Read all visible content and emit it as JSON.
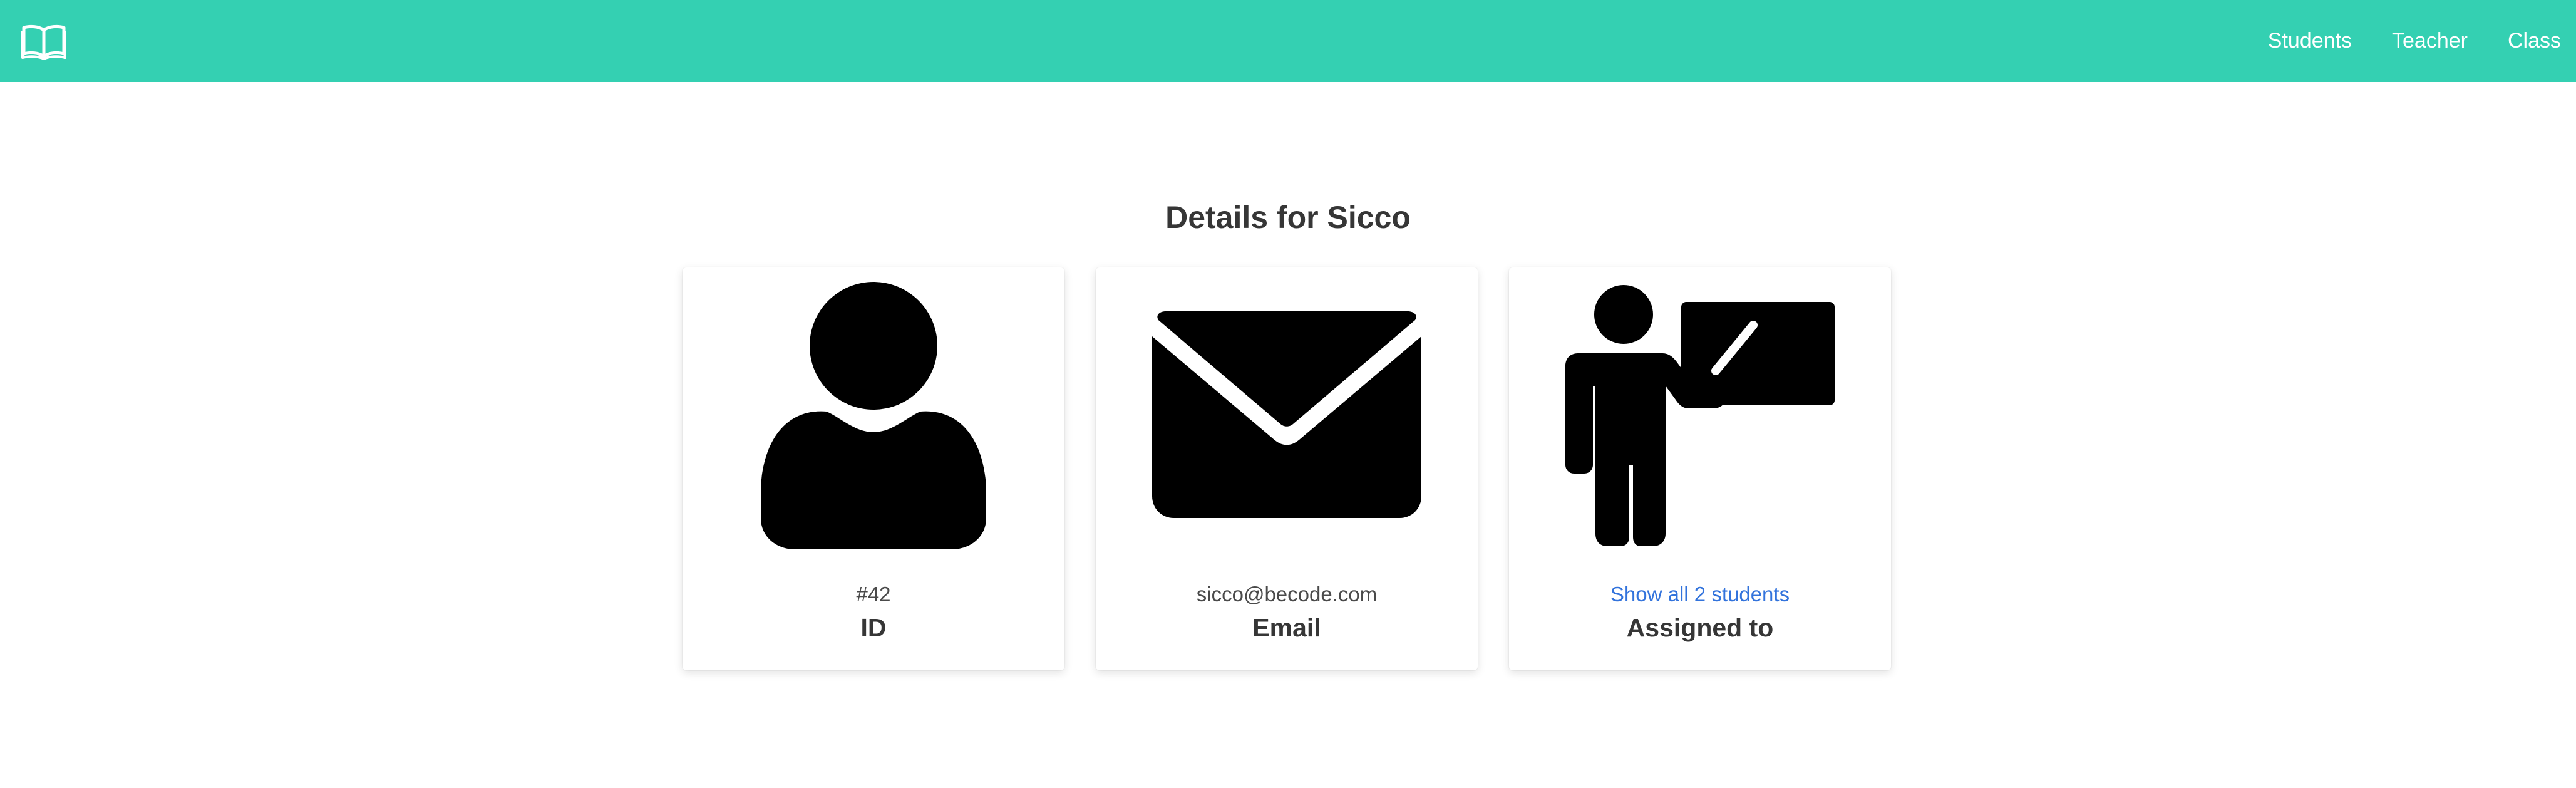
{
  "navbar": {
    "background_color": "#34d0b2",
    "brand_icon": "open-book-icon",
    "links": [
      {
        "label": "Students"
      },
      {
        "label": "Teacher"
      },
      {
        "label": "Class"
      }
    ]
  },
  "main": {
    "title": "Details for Sicco",
    "cards": [
      {
        "icon": "user-icon",
        "value": "#42",
        "label": "ID"
      },
      {
        "icon": "envelope-icon",
        "value": "sicco@becode.com",
        "label": "Email"
      },
      {
        "icon": "teacher-board-icon",
        "value": "Show all 2 students",
        "label": "Assigned to",
        "link_color": "#3273dc"
      }
    ]
  }
}
